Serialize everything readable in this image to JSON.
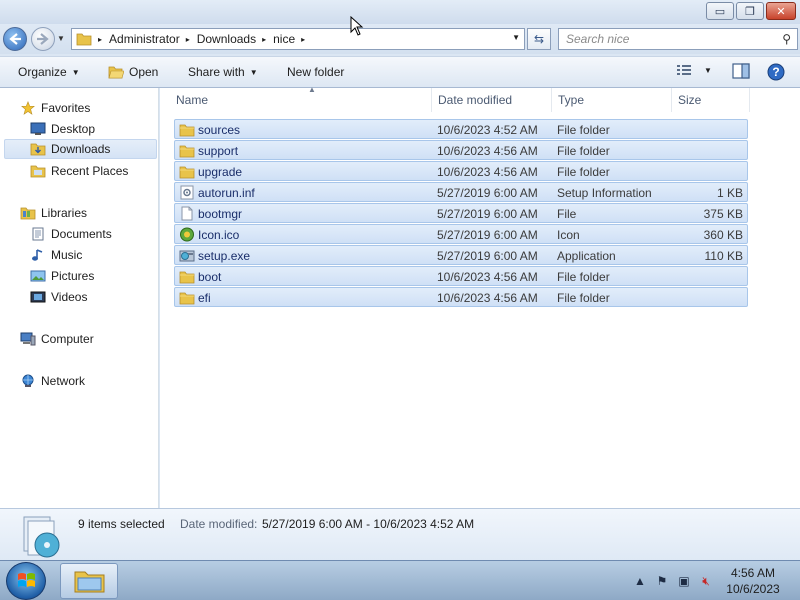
{
  "window": {
    "minimize": "▭",
    "maximize": "❐",
    "close": "✕"
  },
  "nav": {
    "back_icon": "back-arrow-icon",
    "forward_icon": "forward-arrow-icon"
  },
  "address": {
    "breadcrumbs": [
      "Administrator",
      "Downloads",
      "nice"
    ],
    "sep": "▸"
  },
  "search": {
    "placeholder": "Search nice"
  },
  "toolbar": {
    "organize": "Organize",
    "open": "Open",
    "share_with": "Share with",
    "new_folder": "New folder"
  },
  "sidebar": {
    "favorites": "Favorites",
    "desktop": "Desktop",
    "downloads": "Downloads",
    "recent_places": "Recent Places",
    "libraries": "Libraries",
    "documents": "Documents",
    "music": "Music",
    "pictures": "Pictures",
    "videos": "Videos",
    "computer": "Computer",
    "network": "Network"
  },
  "columns": {
    "name": "Name",
    "date": "Date modified",
    "type": "Type",
    "size": "Size"
  },
  "files": [
    {
      "name": "sources",
      "date": "10/6/2023 4:52 AM",
      "type": "File folder",
      "size": "",
      "icon": "folder"
    },
    {
      "name": "support",
      "date": "10/6/2023 4:56 AM",
      "type": "File folder",
      "size": "",
      "icon": "folder"
    },
    {
      "name": "upgrade",
      "date": "10/6/2023 4:56 AM",
      "type": "File folder",
      "size": "",
      "icon": "folder"
    },
    {
      "name": "autorun.inf",
      "date": "5/27/2019 6:00 AM",
      "type": "Setup Information",
      "size": "1 KB",
      "icon": "settings"
    },
    {
      "name": "bootmgr",
      "date": "5/27/2019 6:00 AM",
      "type": "File",
      "size": "375 KB",
      "icon": "file"
    },
    {
      "name": "Icon.ico",
      "date": "5/27/2019 6:00 AM",
      "type": "Icon",
      "size": "360 KB",
      "icon": "ico"
    },
    {
      "name": "setup.exe",
      "date": "5/27/2019 6:00 AM",
      "type": "Application",
      "size": "110 KB",
      "icon": "exe"
    },
    {
      "name": "boot",
      "date": "10/6/2023 4:56 AM",
      "type": "File folder",
      "size": "",
      "icon": "folder"
    },
    {
      "name": "efi",
      "date": "10/6/2023 4:56 AM",
      "type": "File folder",
      "size": "",
      "icon": "folder"
    }
  ],
  "details": {
    "count": "9 items selected",
    "date_label": "Date modified:",
    "date_value": "5/27/2019 6:00 AM - 10/6/2023 4:52 AM"
  },
  "taskbar": {
    "time": "4:56 AM",
    "date": "10/6/2023"
  },
  "colors": {
    "selection": "#cfe0f6",
    "selection_border": "#a8c6ea",
    "name_text": "#1a2e6a"
  }
}
